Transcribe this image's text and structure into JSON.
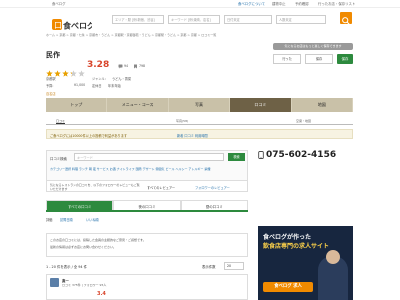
{
  "header": {
    "logo_text": "食べログ",
    "top_links": [
      "食べログについて",
      "建物中止",
      "予約確認",
      "行ったお店・保存リスト",
      "会員登録",
      "ログイン"
    ],
    "area_placeholder": "エリア・駅 [例:新宿、渋谷]",
    "keyword_placeholder": "キーワード [例:焼肉、店名]",
    "date_placeholder": "日付未定",
    "people_placeholder": "人数未定"
  },
  "breadcrumb": "ホーム > 京都 > 京都・七条 > 京都市・うどん > 京都駅・京都御苑・うどん > 京都駅・うどん > 京都 > 京都 > ロコミ一覧",
  "restaurant": {
    "name": "民作",
    "rating": "3.28",
    "rating_value": 3.28,
    "reviews_count": "94",
    "saves_count": "798",
    "nearest_station": "京都駅",
    "genre_label": "ジャンル:",
    "genre": "うどん・香菜",
    "budget_label": "予算:",
    "budget_night": "¥1,000",
    "budget_day": "定休日",
    "holiday": "年末年始",
    "badge": "百名店",
    "phone": "075-602-4156"
  },
  "save_panel": {
    "header": "気になるお店はもっと楽しく保存できます",
    "went": "行った",
    "wish": "保存",
    "save": "保存"
  },
  "nav": {
    "tabs": [
      "トップ",
      "メニュー・コース",
      "写真",
      "ロコミ",
      "地図"
    ],
    "sub_labels": [
      "写真(58)",
      "口コミ",
      "空席・地図"
    ]
  },
  "notice": {
    "text": "ご食べログには10000件以上の投稿で利益があります",
    "link": "新着 口コミ 利用時間"
  },
  "search": {
    "label": "口コミ検索",
    "placeholder": "キーワード",
    "button": "検索",
    "filters": "カテゴリー選択 料理 ランチ 朝 夜 サービス お酒 ナイトライフ 国際 デザート 雰囲気 ビール ヘルシー アレルギー 禁煙"
  },
  "info_text": "気になるレストランの口コミを、以下のフォロワーのレビューもご覧いただけます",
  "review_tabs": {
    "all": "すべての口コミ",
    "night": "夜の口コミ",
    "day": "昼の口コミ",
    "all_reviewers": "すべてのレビュアー",
    "followers": "フォロワーのレビュアー"
  },
  "filter": {
    "label": "評価",
    "option1": "訪問日順",
    "option2": "いいね順"
  },
  "listing": {
    "line1": "このお店の口コミには、投稿した会員の主観的なご意見・ご感想です。",
    "line2": "最新の情報は必ずお店にお問い合わせください。"
  },
  "count": {
    "text": "1 - 20 件を表示 / 全 94 件",
    "sort_label": "表示件数",
    "sort_value": "20"
  },
  "review": {
    "user": "真一",
    "meta": "ロコミ 375件 | フォロワー 95人",
    "score": "3.4"
  },
  "ad": {
    "title": "食べログが作った",
    "subtitle": "飲食店専門の求人サイト",
    "logo": "食べログ 求人"
  },
  "colors": {
    "accent_orange": "#f08a00",
    "rating_red": "#d8442a",
    "green": "#2d8a3e",
    "nav_beige": "#c9c1a8",
    "nav_active": "#6e6146"
  }
}
